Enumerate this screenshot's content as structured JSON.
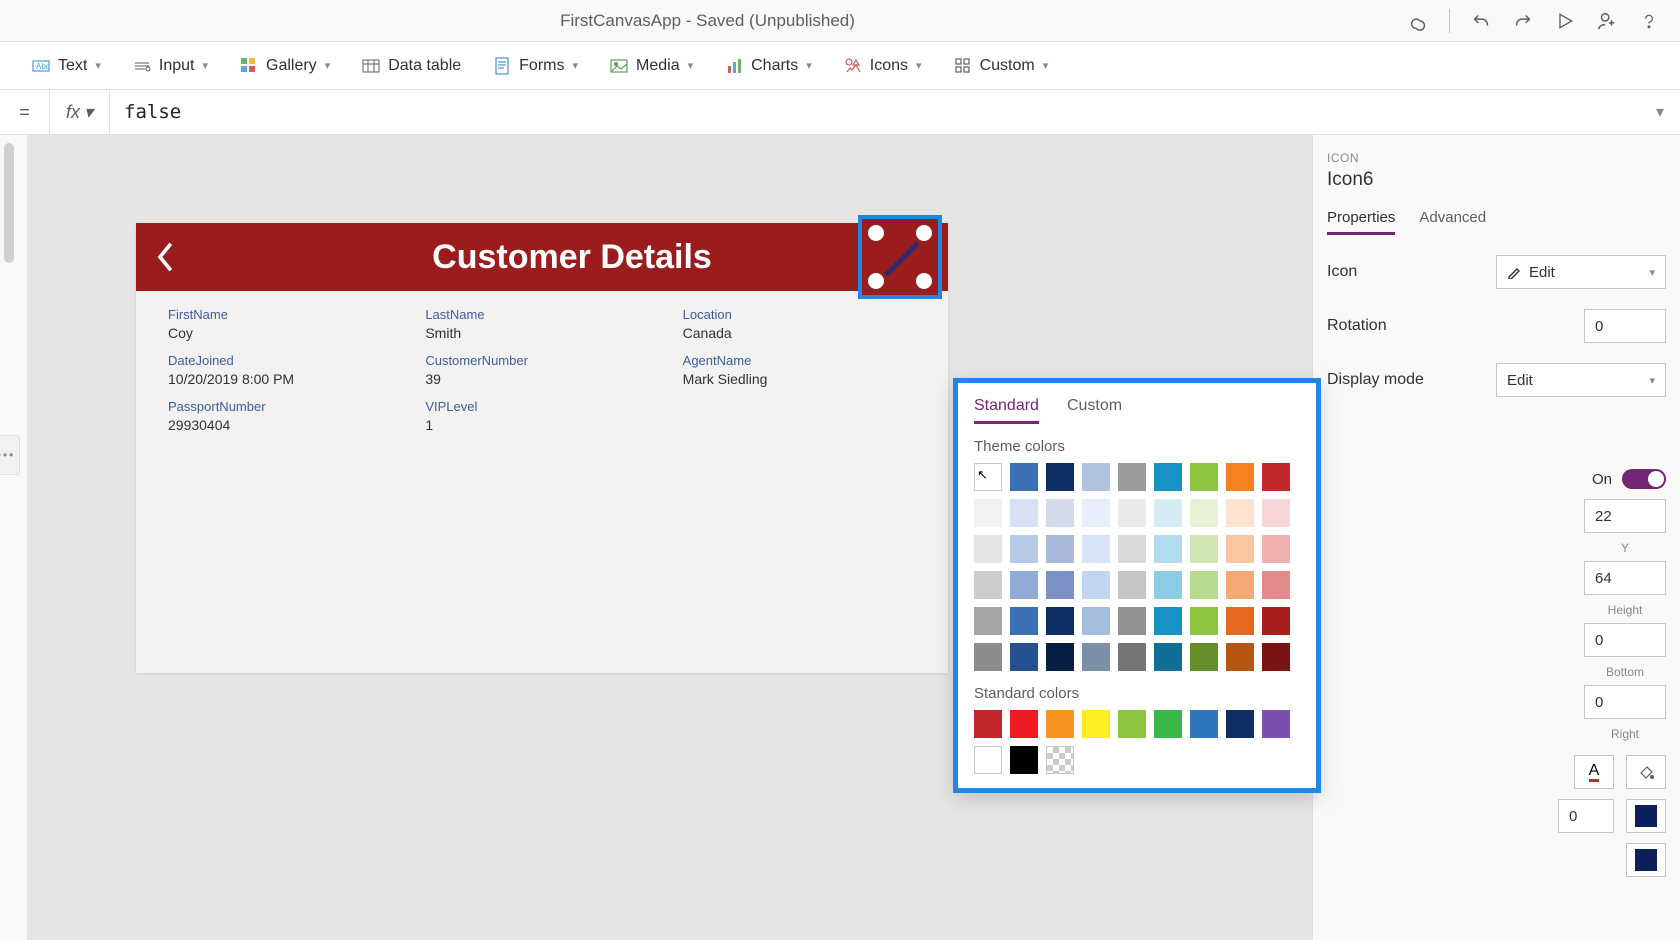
{
  "titlebar": {
    "title": "FirstCanvasApp - Saved (Unpublished)"
  },
  "ribbon": {
    "text": "Text",
    "input": "Input",
    "gallery": "Gallery",
    "datatable": "Data table",
    "forms": "Forms",
    "media": "Media",
    "charts": "Charts",
    "icons": "Icons",
    "custom": "Custom"
  },
  "formula": {
    "equals": "=",
    "fx": "fx",
    "value": "false"
  },
  "canvas": {
    "header_title": "Customer Details",
    "fields": [
      {
        "label": "FirstName",
        "value": "Coy"
      },
      {
        "label": "LastName",
        "value": "Smith"
      },
      {
        "label": "Location",
        "value": "Canada"
      },
      {
        "label": "DateJoined",
        "value": "10/20/2019 8:00 PM"
      },
      {
        "label": "CustomerNumber",
        "value": "39"
      },
      {
        "label": "AgentName",
        "value": "Mark Siedling"
      },
      {
        "label": "PassportNumber",
        "value": "29930404"
      },
      {
        "label": "VIPLevel",
        "value": "1"
      }
    ]
  },
  "props": {
    "kicker": "ICON",
    "name": "Icon6",
    "tab_props": "Properties",
    "tab_adv": "Advanced",
    "icon_label": "Icon",
    "icon_value": "Edit",
    "rotation_label": "Rotation",
    "rotation_value": "0",
    "display_label": "Display mode",
    "display_value": "Edit",
    "on_label": "On",
    "v22": "22",
    "v64": "64",
    "y_lbl": "Y",
    "height_lbl": "Height",
    "bottom_lbl": "Bottom",
    "right_lbl": "Right",
    "zero1": "0",
    "zero2": "0",
    "zero3": "0"
  },
  "colorpicker": {
    "tab_std": "Standard",
    "tab_custom": "Custom",
    "theme_lbl": "Theme colors",
    "std_lbl": "Standard colors",
    "theme_colors": [
      [
        "#ffffff",
        "#3b6fb6",
        "#0b2e63",
        "#b0c2e0",
        "#9b9b9b",
        "#1993c6",
        "#8cc63f",
        "#f58220",
        "#c1272d"
      ],
      [
        "#f2f2f2",
        "#d6e0f2",
        "#d3dbea",
        "#e6eefb",
        "#eaeaea",
        "#d4ecf6",
        "#e6f1d6",
        "#fde3d0",
        "#f6d6d6"
      ],
      [
        "#e6e6e6",
        "#b8c9e6",
        "#aab9d9",
        "#d7e3f6",
        "#d9d9d9",
        "#b3dbee",
        "#cfe6b3",
        "#f9c6a2",
        "#eeb0b0"
      ],
      [
        "#cccccc",
        "#90aad6",
        "#7d92c4",
        "#c1d4f0",
        "#c5c5c5",
        "#8ecbe5",
        "#b7dc90",
        "#f4a873",
        "#e58a8a"
      ],
      [
        "#a6a6a6",
        "#3b6fb6",
        "#0b2e63",
        "#a4bddc",
        "#929292",
        "#1993c6",
        "#8cc63f",
        "#e2691e",
        "#a61e1e"
      ],
      [
        "#8c8c8c",
        "#27508f",
        "#061e44",
        "#7d8fa6",
        "#747474",
        "#0f6e95",
        "#668f2c",
        "#b4560f",
        "#7a1414"
      ]
    ],
    "standard_colors": [
      [
        "#c1272d",
        "#ed1c24",
        "#f7931e",
        "#fcee21",
        "#8cc63f",
        "#39b54a",
        "#2e77bb",
        "#0b2e63",
        "#7b4fb0"
      ],
      [
        "#ffffff",
        "#000000",
        "trans"
      ]
    ]
  }
}
